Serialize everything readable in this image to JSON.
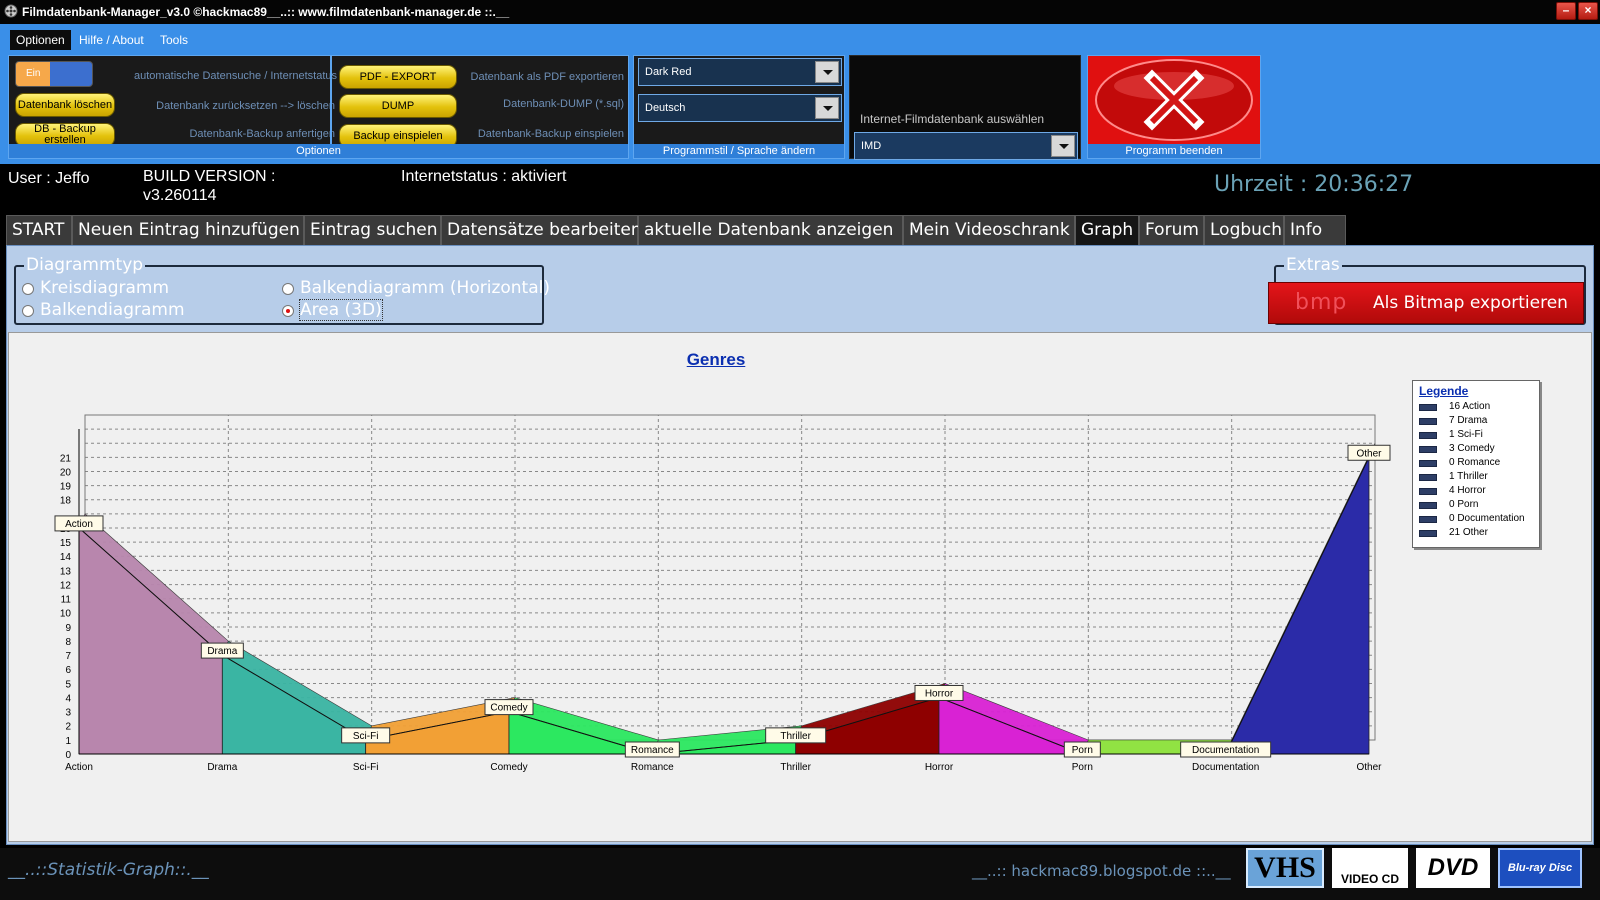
{
  "window": {
    "title": "Filmdatenbank-Manager_v3.0 ©hackmac89__..:: www.filmdatenbank-manager.de ::.__"
  },
  "menu": {
    "items": [
      "Optionen",
      "Hilfe / About",
      "Tools"
    ]
  },
  "ribbon": {
    "toggle_label": "Ein",
    "hint_autosearch": "automatische Datensuche / Internetstatus",
    "btn_db_delete": "Datenbank löschen",
    "hint_db_reset": "Datenbank zurücksetzen --> löschen",
    "btn_db_backup": "DB - Backup erstellen",
    "hint_db_backup": "Datenbank-Backup anfertigen",
    "btn_pdf": "PDF - EXPORT",
    "hint_pdf": "Datenbank als PDF exportieren",
    "btn_dump": "DUMP",
    "hint_dump": "Datenbank-DUMP (*.sql)",
    "btn_backup_import": "Backup einspielen",
    "hint_backup_import": "Datenbank-Backup einspielen",
    "group_options": "Optionen",
    "style_value": "Dark Red",
    "language_value": "Deutsch",
    "group_style": "Programmstil / Sprache ändern",
    "imdb_label": "Internet-Filmdatenbank auswählen",
    "imdb_value": "IMD",
    "group_exit": "Programm beenden"
  },
  "status": {
    "user": "User : Jeffo",
    "build_label": "BUILD VERSION :",
    "build_value": "v3.260114",
    "internet": "Internetstatus : aktiviert",
    "clock": "Uhrzeit : 20:36:27"
  },
  "tabs": [
    "START",
    "Neuen Eintrag hinzufügen",
    "Eintrag suchen",
    "Datensätze bearbeiten",
    "aktuelle Datenbank anzeigen",
    "Mein Videoschrank",
    "Graph",
    "Forum",
    "Logbuch",
    "Info"
  ],
  "diagram": {
    "group_title": "Diagrammtyp",
    "options": [
      "Kreisdiagramm",
      "Balkendiagramm",
      "Balkendiagramm (Horizontal)",
      "Area (3D)"
    ],
    "selected": "Area (3D)"
  },
  "extras": {
    "group_title": "Extras",
    "bmp_label": "bmp",
    "export_label": "Als Bitmap exportieren"
  },
  "legend": {
    "title": "Legende",
    "items": [
      "16 Action",
      "7 Drama",
      "1 Sci-Fi",
      "3 Comedy",
      "0 Romance",
      "1 Thriller",
      "4 Horror",
      "0 Porn",
      "0 Documentation",
      "21 Other"
    ]
  },
  "footer": {
    "left": "__..::Statistik-Graph::.__",
    "right": "__..:: hackmac89.blogspot.de ::..__",
    "logos": [
      "VHS",
      "VIDEO CD",
      "DVD",
      "Blu-ray Disc"
    ]
  },
  "chart_data": {
    "type": "area",
    "title": "Genres",
    "categories": [
      "Action",
      "Drama",
      "Sci-Fi",
      "Comedy",
      "Romance",
      "Thriller",
      "Horror",
      "Porn",
      "Documentation",
      "Other"
    ],
    "values": [
      16,
      7,
      1,
      3,
      0,
      1,
      4,
      0,
      0,
      21
    ],
    "yticks": [
      0,
      1,
      2,
      3,
      4,
      5,
      6,
      7,
      8,
      9,
      10,
      11,
      12,
      13,
      14,
      15,
      16,
      18,
      19,
      20,
      21
    ],
    "ylim": [
      0,
      23
    ],
    "colors": [
      "#b886ad",
      "#4a27e3",
      "#3ab5a3",
      "#f2a035",
      "#2ce860",
      "#2ce860",
      "#8e0000",
      "#d922d4",
      "#8ce23a",
      "#2b2ba8"
    ],
    "grid": true,
    "legend_position": "right"
  }
}
